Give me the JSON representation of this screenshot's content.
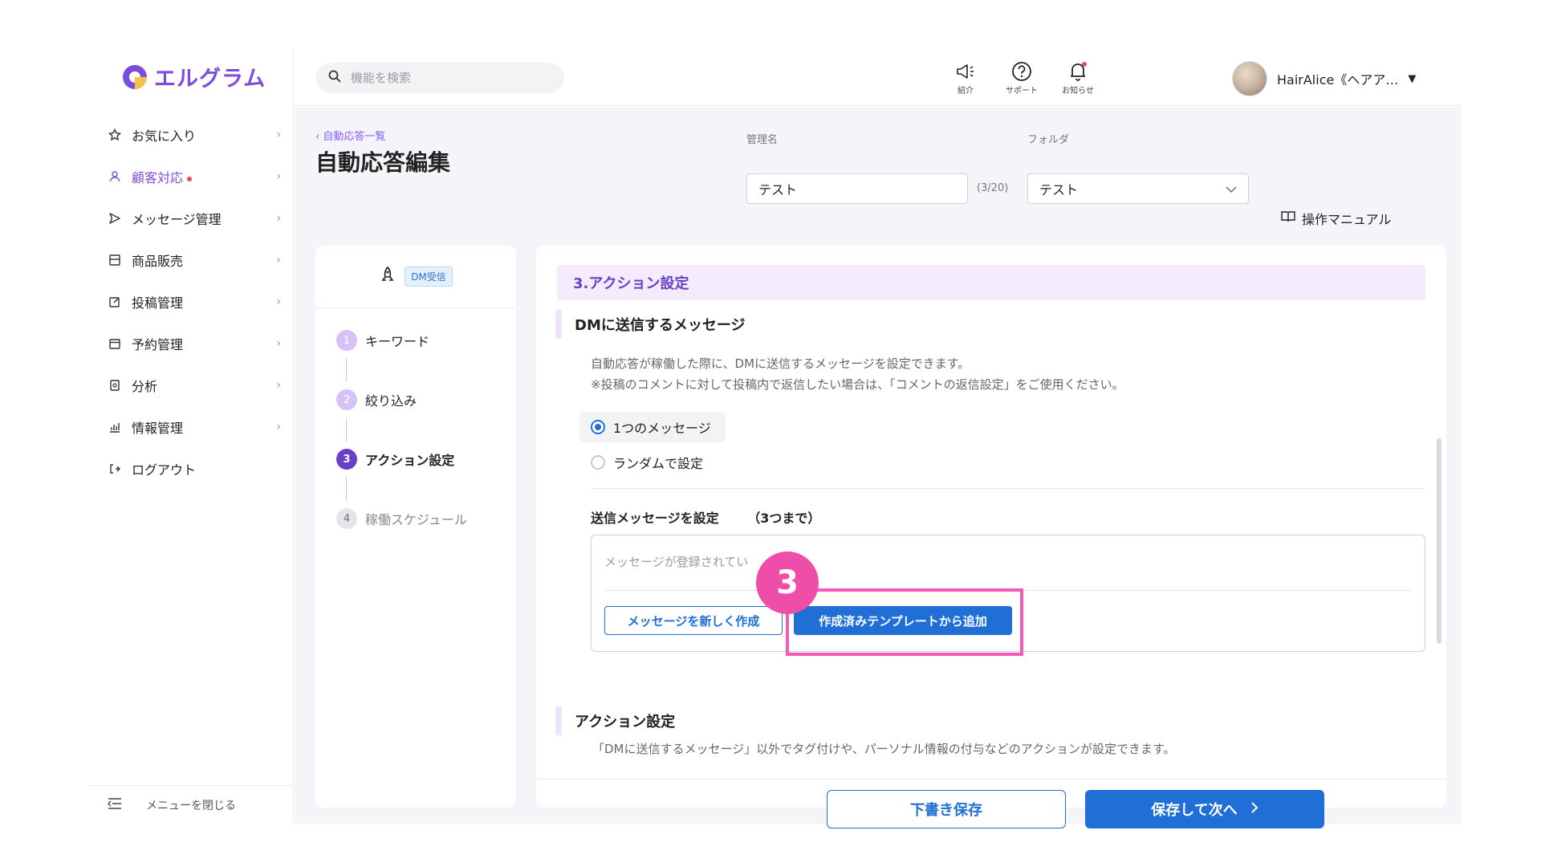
{
  "brand": {
    "name": "エルグラム"
  },
  "sidebar": {
    "items": [
      {
        "label": "お気に入り",
        "icon": "star-icon"
      },
      {
        "label": "顧客対応",
        "icon": "person-icon",
        "active": true,
        "dot": true
      },
      {
        "label": "メッセージ管理",
        "icon": "send-icon"
      },
      {
        "label": "商品販売",
        "icon": "store-icon"
      },
      {
        "label": "投稿管理",
        "icon": "edit-icon"
      },
      {
        "label": "予約管理",
        "icon": "calendar-icon"
      },
      {
        "label": "分析",
        "icon": "report-icon"
      },
      {
        "label": "情報管理",
        "icon": "chart-icon"
      },
      {
        "label": "ログアウト",
        "icon": "logout-icon"
      }
    ],
    "close_menu": "メニューを閉じる"
  },
  "header": {
    "search_placeholder": "機能を検索",
    "icons": [
      {
        "label": "紹介",
        "icon": "megaphone-icon"
      },
      {
        "label": "サポート",
        "icon": "help-icon"
      },
      {
        "label": "お知らせ",
        "icon": "bell-icon"
      }
    ],
    "user_name": "HairAlice《ヘアア…"
  },
  "page": {
    "breadcrumb": "自動応答一覧",
    "title": "自動応答編集",
    "name_label": "管理名",
    "name_value": "テスト",
    "name_counter": "(3/20)",
    "folder_label": "フォルダ",
    "folder_value": "テスト",
    "manual": "操作マニュアル"
  },
  "steps": {
    "tag": "DM受信",
    "list": [
      {
        "num": "1",
        "label": "キーワード"
      },
      {
        "num": "2",
        "label": "絞り込み"
      },
      {
        "num": "3",
        "label": "アクション設定"
      },
      {
        "num": "4",
        "label": "稼働スケジュール"
      }
    ]
  },
  "main": {
    "section_title": "3.アクション設定",
    "dm_heading": "DMに送信するメッセージ",
    "dm_desc1": "自動応答が稼働した際に、DMに送信するメッセージを設定できます。",
    "dm_desc2": "※投稿のコメントに対して投稿内で返信したい場合は、「コメントの返信設定」をご使用ください。",
    "radio_one": "1つのメッセージ",
    "radio_random": "ランダムで設定",
    "send_title": "送信メッセージを設定",
    "send_limit": "（3つまで）",
    "empty_msg": "メッセージが登録されてい",
    "btn_new": "メッセージを新しく作成",
    "btn_template": "作成済みテンプレートから追加",
    "callout_num": "3",
    "action_heading": "アクション設定",
    "action_desc": "「DMに送信するメッセージ」以外でタグ付けや、パーソナル情報の付与などのアクションが設定できます。"
  },
  "footer": {
    "draft": "下書き保存",
    "save_next": "保存して次へ"
  },
  "colors": {
    "brand_purple": "#7c4ddb",
    "primary_blue": "#1f6fd6",
    "highlight_pink": "#f25bb8"
  }
}
